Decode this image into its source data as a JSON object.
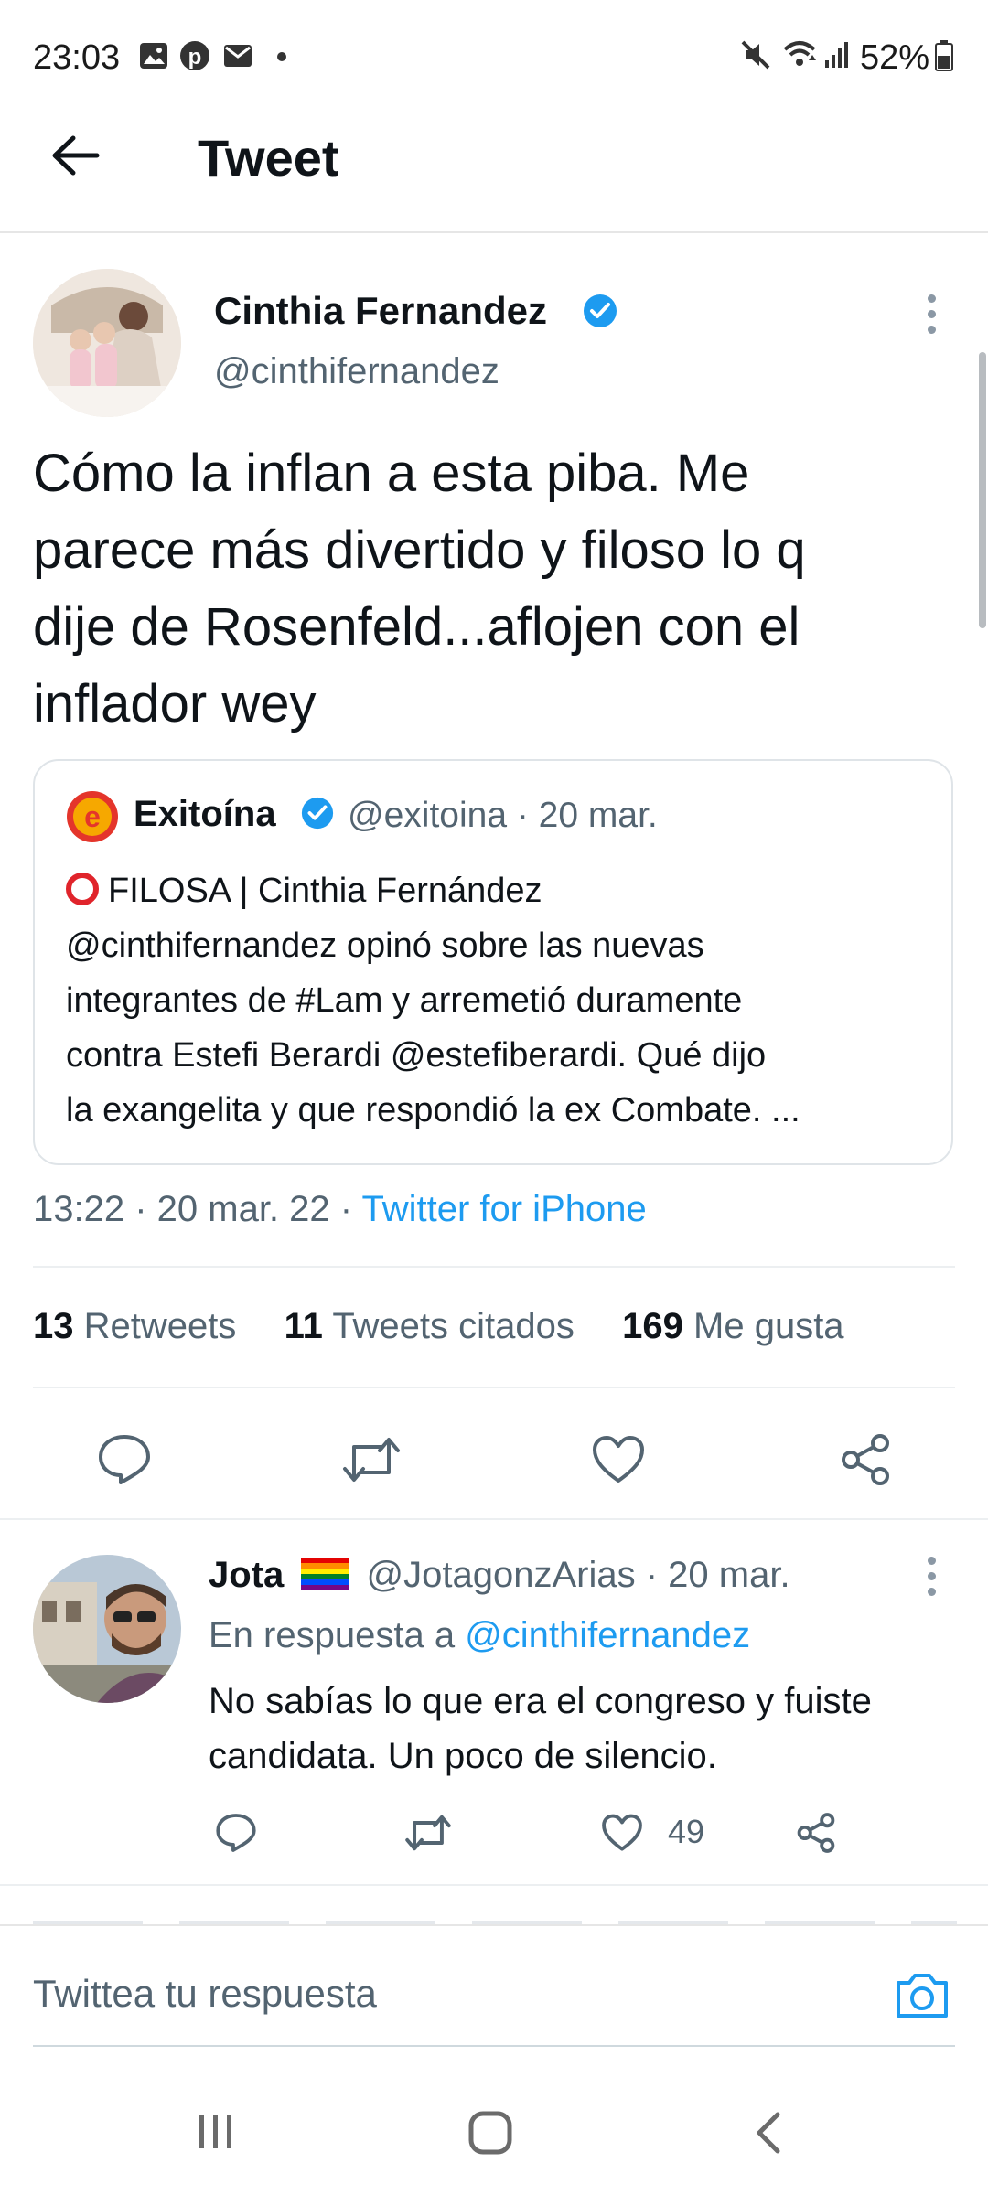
{
  "status_bar": {
    "time": "23:03",
    "battery": "52%",
    "left_icons": [
      "gallery-icon",
      "pinterest-icon",
      "mail-icon",
      "dot-icon"
    ],
    "right_icons": [
      "mute-icon",
      "wifi-icon",
      "signal-icon",
      "battery-icon"
    ]
  },
  "header": {
    "title": "Tweet"
  },
  "tweet": {
    "author_name": "Cinthia Fernandez",
    "author_handle": "@cinthifernandez",
    "verified": true,
    "text_lines": [
      "Cómo la inflan a esta piba. Me",
      "parece más divertido y filoso lo q",
      "dije de Rosenfeld...aflojen con el",
      "inflador wey"
    ],
    "quote": {
      "name": "Exitoína",
      "handle": "@exitoina",
      "date": "· 20 mar.",
      "lines": [
        "FILOSA | Cinthia Fernández",
        "@cinthifernandez opinó sobre las nuevas",
        "integrantes de #Lam y arremetió duramente",
        "contra Estefi Berardi @estefiberardi. Qué dijo",
        "la exangelita y que respondió la ex Combate. ..."
      ]
    },
    "time": "13:22 · 20 mar. 22 ·",
    "source": "Twitter for iPhone",
    "stats": {
      "retweets_count": "13",
      "retweets_label": "Retweets",
      "quotes_count": "11",
      "quotes_label": "Tweets citados",
      "likes_count": "169",
      "likes_label": "Me gusta"
    }
  },
  "reply": {
    "name": "Jota",
    "handle": "@JotagonzArias",
    "date": "· 20 mar.",
    "replying_prefix": "En respuesta a",
    "replying_to": "@cinthifernandez",
    "text_lines": [
      "No sabías lo que era el congreso y fuiste",
      "candidata. Un poco de silencio."
    ],
    "likes": "49"
  },
  "composer": {
    "placeholder": "Twittea tu respuesta"
  },
  "colors": {
    "accent": "#1d9bf0",
    "muted": "#536471",
    "text": "#0f1419"
  }
}
